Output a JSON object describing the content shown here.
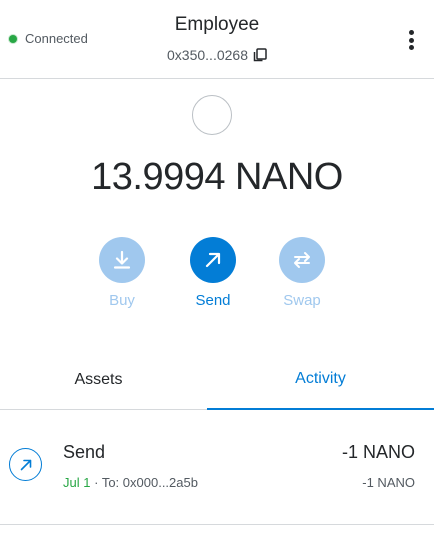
{
  "header": {
    "connection_status": "Connected",
    "account_name": "Employee",
    "account_address": "0x350...0268"
  },
  "balance": {
    "amount": "13.9994 NANO"
  },
  "actions": [
    {
      "label": "Buy",
      "icon": "download-icon"
    },
    {
      "label": "Send",
      "icon": "arrow-up-right-icon"
    },
    {
      "label": "Swap",
      "icon": "swap-arrows-icon"
    }
  ],
  "tabs": {
    "assets": "Assets",
    "activity": "Activity",
    "active": "Activity"
  },
  "activity": [
    {
      "title": "Send",
      "date": "Jul 1",
      "separator": "·",
      "recipient": "To: 0x000...2a5b",
      "amount_primary": "-1 NANO",
      "amount_secondary": "-1 NANO"
    }
  ],
  "colors": {
    "accent": "#037dd6",
    "accent_light": "#a0c8ee",
    "connected": "#28a745",
    "text": "#24272a"
  }
}
